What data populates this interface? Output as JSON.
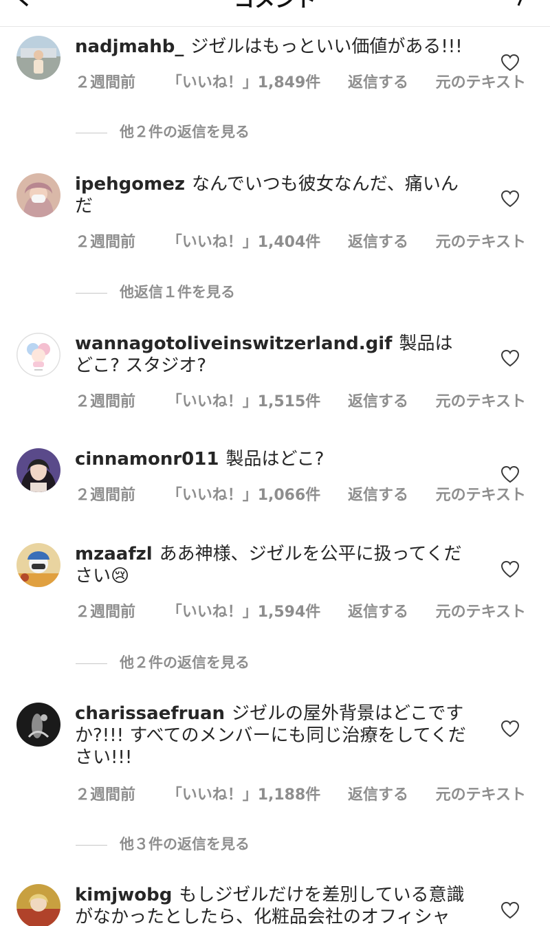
{
  "header": {
    "title": "コメント"
  },
  "comments": [
    {
      "username": "nadjmahb_",
      "text": "ジゼルはもっといい価値がある!!!",
      "time": "２週間前",
      "likes": "「いいね！」1,849件",
      "reply": "返信する",
      "translate": "元のテキスト",
      "more_replies": "他２件の返信を見る"
    },
    {
      "username": "ipehgomez",
      "text": "なんでいつも彼女なんだ、痛いんだ",
      "time": "２週間前",
      "likes": "「いいね！」1,404件",
      "reply": "返信する",
      "translate": "元のテキスト",
      "more_replies": "他返信１件を見る"
    },
    {
      "username": "wannagotoliveinswitzerland.gif",
      "text": "製品はどこ? スタジオ?",
      "time": "２週間前",
      "likes": "「いいね！」1,515件",
      "reply": "返信する",
      "translate": "元のテキスト"
    },
    {
      "username": "cinnamonr011",
      "text": "製品はどこ?",
      "time": "２週間前",
      "likes": "「いいね！」1,066件",
      "reply": "返信する",
      "translate": "元のテキスト"
    },
    {
      "username": "mzaafzl",
      "text": "ああ神様、ジゼルを公平に扱ってください😢",
      "time": "２週間前",
      "likes": "「いいね！」1,594件",
      "reply": "返信する",
      "translate": "元のテキスト",
      "more_replies": "他２件の返信を見る"
    },
    {
      "username": "charissaefruan",
      "text": "ジゼルの屋外背景はどこですか?!!! すべてのメンバーにも同じ治療をしてください!!!",
      "time": "２週間前",
      "likes": "「いいね！」1,188件",
      "reply": "返信する",
      "translate": "元のテキスト",
      "more_replies": "他３件の返信を見る"
    },
    {
      "username": "kimjwobg",
      "text": "もしジゼルだけを差別している意識がなかったとしたら、化粧品会社のオフィシャ"
    }
  ],
  "icons": {
    "heart": "heart-outline-icon",
    "back": "chevron-left-icon",
    "send": "paper-plane-icon"
  },
  "colors": {
    "meta": "#8e8e8e",
    "text": "#262626"
  }
}
